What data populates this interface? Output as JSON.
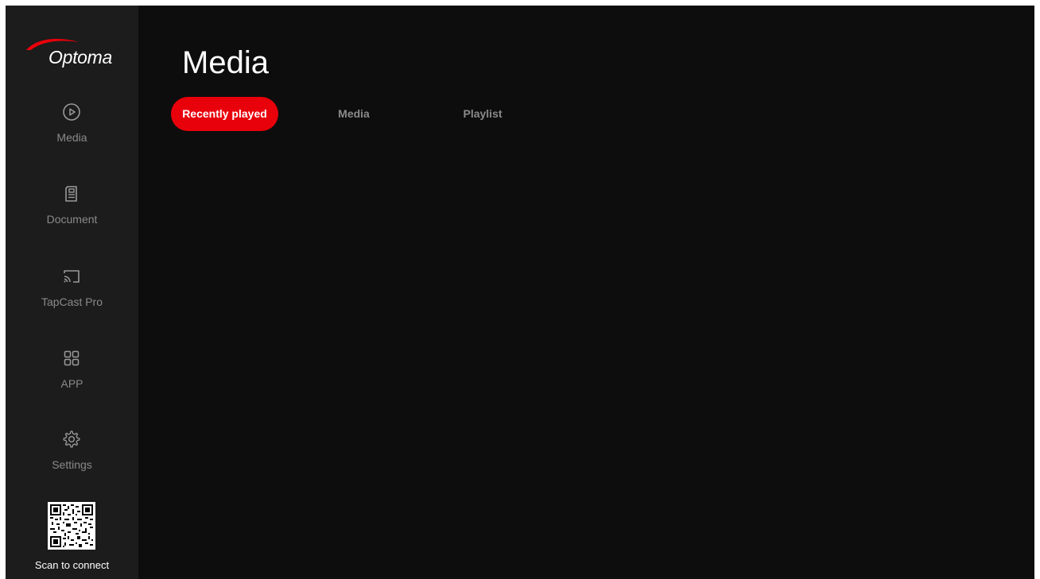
{
  "brand": {
    "logo_text": "Optoma",
    "accent_color": "#e8000b"
  },
  "sidebar": {
    "items": [
      {
        "label": "Media",
        "icon": "play-circle-icon"
      },
      {
        "label": "Document",
        "icon": "document-icon"
      },
      {
        "label": "TapCast Pro",
        "icon": "cast-icon"
      },
      {
        "label": "APP",
        "icon": "apps-grid-icon"
      },
      {
        "label": "Settings",
        "icon": "gear-icon"
      }
    ],
    "qr_icon": "qr-code-icon",
    "scan_label": "Scan to connect"
  },
  "main": {
    "title": "Media",
    "tabs": [
      {
        "label": "Recently played",
        "active": true
      },
      {
        "label": "Media",
        "active": false
      },
      {
        "label": "Playlist",
        "active": false
      }
    ]
  }
}
